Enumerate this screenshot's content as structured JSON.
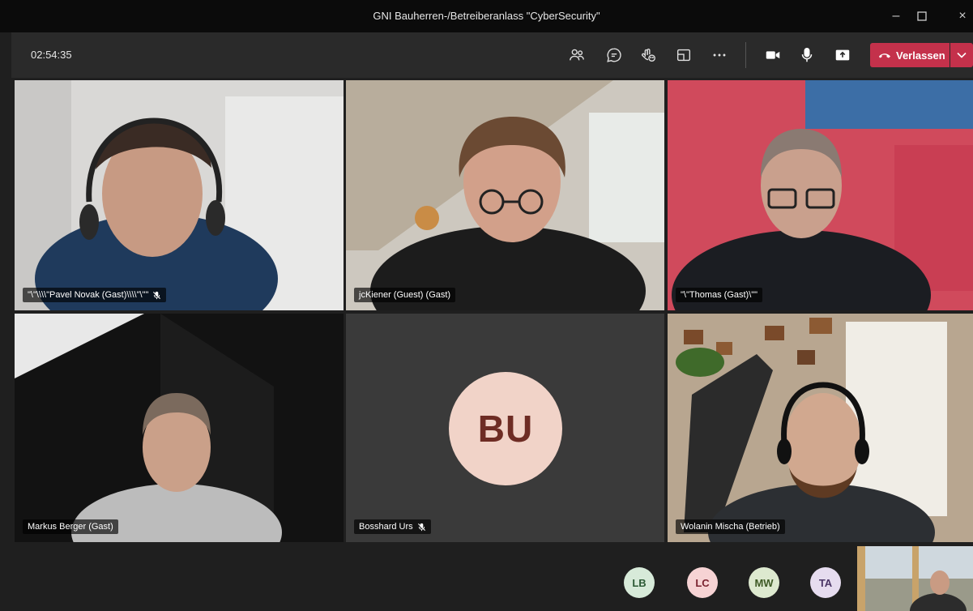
{
  "window": {
    "title": "GNI Bauherren-/Betreiberanlass \"CyberSecurity\""
  },
  "toolbar": {
    "timer": "02:54:35",
    "leave_label": "Verlassen"
  },
  "participants": [
    {
      "name": "\"\\\"\\\\\\\\\"Pavel Novak (Gast)\\\\\\\\\"\\\"\"",
      "muted": true
    },
    {
      "name": "jcKiener (Guest) (Gast)",
      "muted": false
    },
    {
      "name": "\"\\\"Thomas (Gast)\\\"\"",
      "muted": false
    },
    {
      "name": "Markus Berger (Gast)",
      "muted": false
    },
    {
      "name": "Bosshard Urs",
      "muted": true,
      "initials": "BU"
    },
    {
      "name": "Wolanin Mischa (Betrieb)",
      "muted": false
    }
  ],
  "overflow": [
    {
      "initials": "LB",
      "bg": "#d7ead9",
      "fg": "#2c5a35"
    },
    {
      "initials": "LC",
      "bg": "#f6d3d4",
      "fg": "#7a2330"
    },
    {
      "initials": "MW",
      "bg": "#dde9cf",
      "fg": "#3e5a25"
    },
    {
      "initials": "TA",
      "bg": "#e6dcef",
      "fg": "#4a3566"
    }
  ],
  "colors": {
    "leave": "#c4314b",
    "titlebar": "#0b0b0b",
    "toolbar": "#2a2a2a"
  }
}
